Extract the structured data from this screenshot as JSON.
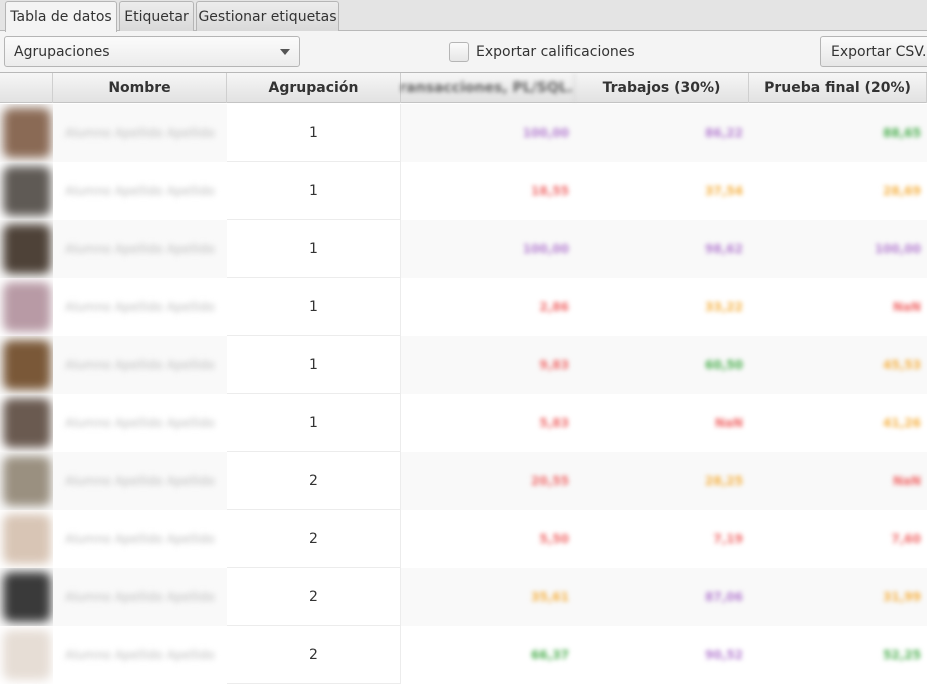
{
  "tabs": [
    {
      "label": "Tabla de datos",
      "active": true
    },
    {
      "label": "Etiquetar",
      "active": false
    },
    {
      "label": "Gestionar etiquetas",
      "active": false
    }
  ],
  "toolbar": {
    "grouping_combo": "Agrupaciones",
    "export_grades_label": "Exportar calificaciones",
    "export_grades_checked": false,
    "export_csv_label": "Exportar CSV..."
  },
  "table": {
    "columns": [
      "",
      "Nombre",
      "Agrupación",
      "Transacciones, PL/SQL...",
      "Trabajos (30%)",
      "Prueba final (20%)"
    ],
    "rows": [
      {
        "name": "Alumno Apellido Apellido",
        "group": "1",
        "v1": "100,00",
        "v2": "86,22",
        "v3": "88,65",
        "c1": "#b57fd1",
        "c2": "#b57fd1",
        "c3": "#4caf50",
        "avatar": "#8a6a55"
      },
      {
        "name": "Alumno Apellido Apellido",
        "group": "1",
        "v1": "18,55",
        "v2": "37,54",
        "v3": "28,69",
        "c1": "#f06868",
        "c2": "#f5b041",
        "c3": "#f5b041",
        "avatar": "#5f5a55"
      },
      {
        "name": "Alumno Apellido Apellido",
        "group": "1",
        "v1": "100,00",
        "v2": "98,62",
        "v3": "100,00",
        "c1": "#b57fd1",
        "c2": "#b57fd1",
        "c3": "#b57fd1",
        "avatar": "#4e4238"
      },
      {
        "name": "Alumno Apellido Apellido",
        "group": "1",
        "v1": "2,86",
        "v2": "33,22",
        "v3": "NaN",
        "c1": "#f06868",
        "c2": "#f5b041",
        "c3": "#f06868",
        "avatar": "#b89aa5"
      },
      {
        "name": "Alumno Apellido Apellido",
        "group": "1",
        "v1": "9,83",
        "v2": "60,50",
        "v3": "45,53",
        "c1": "#f06868",
        "c2": "#4caf50",
        "c3": "#f5b041",
        "avatar": "#7a5838"
      },
      {
        "name": "Alumno Apellido Apellido",
        "group": "1",
        "v1": "5,83",
        "v2": "NaN",
        "v3": "41,26",
        "c1": "#f06868",
        "c2": "#f06868",
        "c3": "#f5b041",
        "avatar": "#6a5a50"
      },
      {
        "name": "Alumno Apellido Apellido",
        "group": "2",
        "v1": "20,55",
        "v2": "28,25",
        "v3": "NaN",
        "c1": "#f06868",
        "c2": "#f5b041",
        "c3": "#f06868",
        "avatar": "#9a9080"
      },
      {
        "name": "Alumno Apellido Apellido",
        "group": "2",
        "v1": "5,50",
        "v2": "7,19",
        "v3": "7,60",
        "c1": "#f06868",
        "c2": "#f06868",
        "c3": "#f06868",
        "avatar": "#d8c5b5"
      },
      {
        "name": "Alumno Apellido Apellido",
        "group": "2",
        "v1": "35,61",
        "v2": "87,06",
        "v3": "31,99",
        "c1": "#f5b041",
        "c2": "#b57fd1",
        "c3": "#f5b041",
        "avatar": "#3a3a3a"
      },
      {
        "name": "Alumno Apellido Apellido",
        "group": "2",
        "v1": "66,37",
        "v2": "90,52",
        "v3": "52,25",
        "c1": "#4caf50",
        "c2": "#b57fd1",
        "c3": "#4caf50",
        "avatar": "#e6ddd5"
      }
    ]
  }
}
